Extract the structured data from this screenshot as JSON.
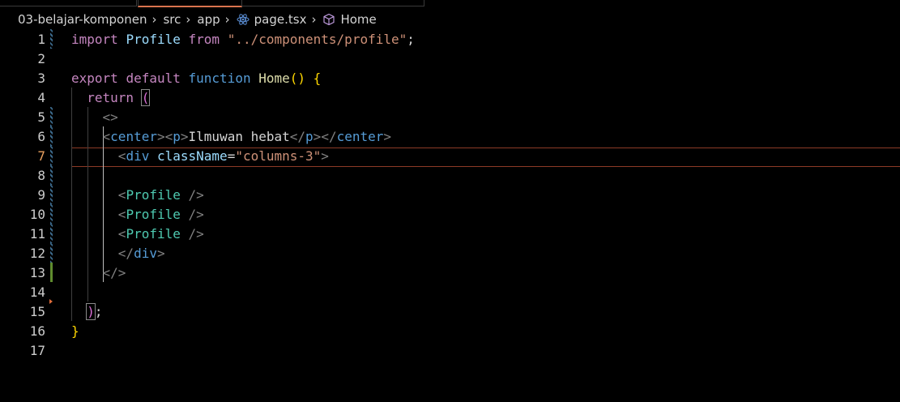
{
  "breadcrumb": {
    "folder": "03-belajar-komponen",
    "sub": "src",
    "dir": "app",
    "file": "page.tsx",
    "symbol": "Home"
  },
  "editor": {
    "line_numbers": [
      "1",
      "2",
      "3",
      "4",
      "5",
      "6",
      "7",
      "8",
      "9",
      "10",
      "11",
      "12",
      "13",
      "14",
      "15",
      "16",
      "17"
    ],
    "tokens": {
      "import": "import",
      "profile_ident": "Profile",
      "from": "from",
      "import_path": "\"../components/profile\"",
      "semicolon": ";",
      "export": "export",
      "default": "default",
      "function": "function",
      "home": "Home",
      "parens": "()",
      "open_brace": "{",
      "return": "return",
      "open_paren": "(",
      "fragment_open": "<>",
      "lt": "<",
      "gt": ">",
      "close_lt": "</",
      "center": "center",
      "p": "p",
      "ilmuwan_text": "Ilmuwan hebat",
      "div": "div",
      "classname_attr": "className",
      "eq": "=",
      "classname_value": "\"columns-3\"",
      "self_close": " />",
      "fragment_close": "</>",
      "close_paren": ")",
      "close_brace": "}"
    }
  }
}
